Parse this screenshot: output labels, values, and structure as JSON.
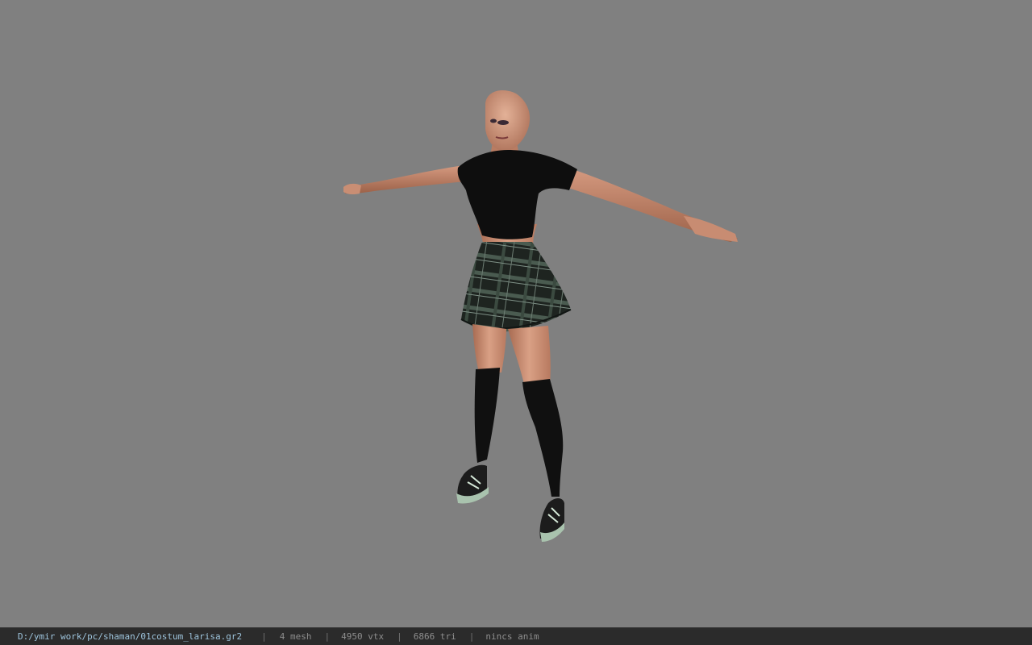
{
  "viewer": {
    "background_color": "#808080",
    "scene_object": "character-model"
  },
  "statusbar": {
    "file_path": "D:/ymir work/pc/shaman/01costum_larisa.gr2",
    "separator": "|",
    "mesh": "4 mesh",
    "vertices": "4950 vtx",
    "triangles": "6866 tri",
    "animation": "nincs anim"
  }
}
